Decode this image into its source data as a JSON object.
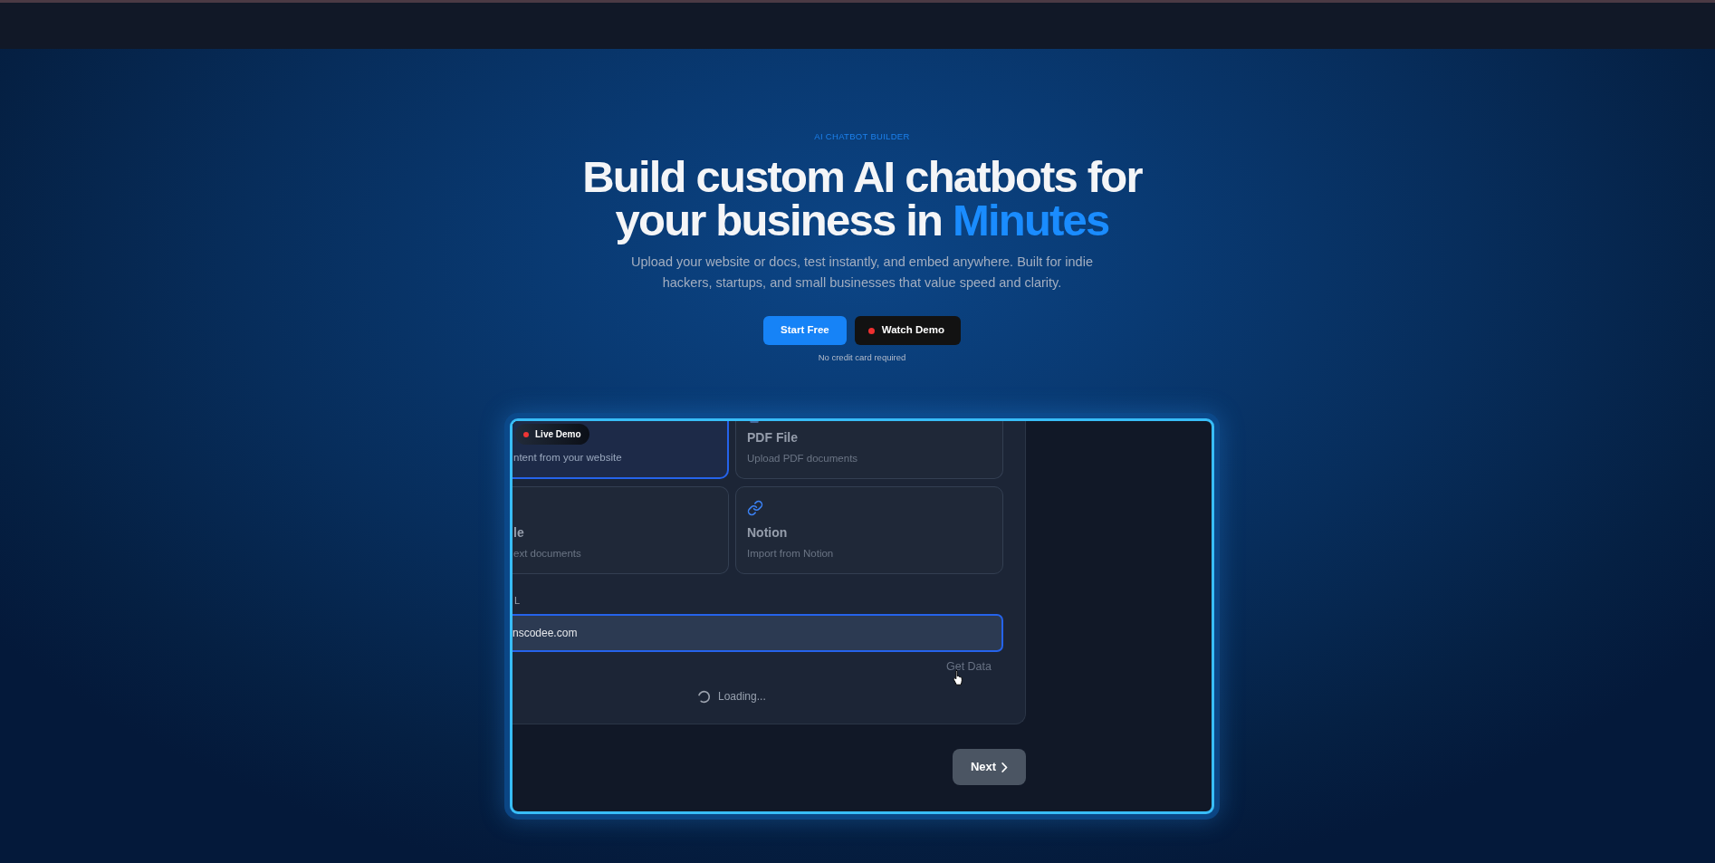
{
  "hero": {
    "eyebrow": "AI CHATBOT BUILDER",
    "headline": "Build custom AI chatbots for your business in",
    "headline_highlight": "Minutes",
    "subtitle": "Upload your website or docs, test instantly, and embed anywhere. Built for indie hackers, startups, and small businesses that value speed and clarity.",
    "buttons": [
      {
        "label": "Start Free",
        "kind": "primary"
      },
      {
        "label": "Watch Demo",
        "kind": "dark"
      }
    ],
    "note": "No credit card required"
  },
  "demo": {
    "badge": "Live Demo",
    "source_rows": [
      {
        "tiles": [
          {
            "kind": "plain",
            "description": "ntent from your website",
            "selected": true
          },
          {
            "kind": "file",
            "title": "PDF File",
            "description": "Upload PDF documents",
            "selected": false
          }
        ]
      },
      {
        "tiles": [
          {
            "kind": "plain",
            "title": "le",
            "description": "ext documents",
            "selected": false
          },
          {
            "kind": "link",
            "title": "Notion",
            "description": "Import from Notion",
            "selected": false
          }
        ]
      }
    ],
    "url_field": {
      "label": "L",
      "value": "nscodee.com"
    },
    "get_data": {
      "label": "Get Data",
      "disabled": true
    },
    "loading": "Loading...",
    "next_button": "Next"
  }
}
